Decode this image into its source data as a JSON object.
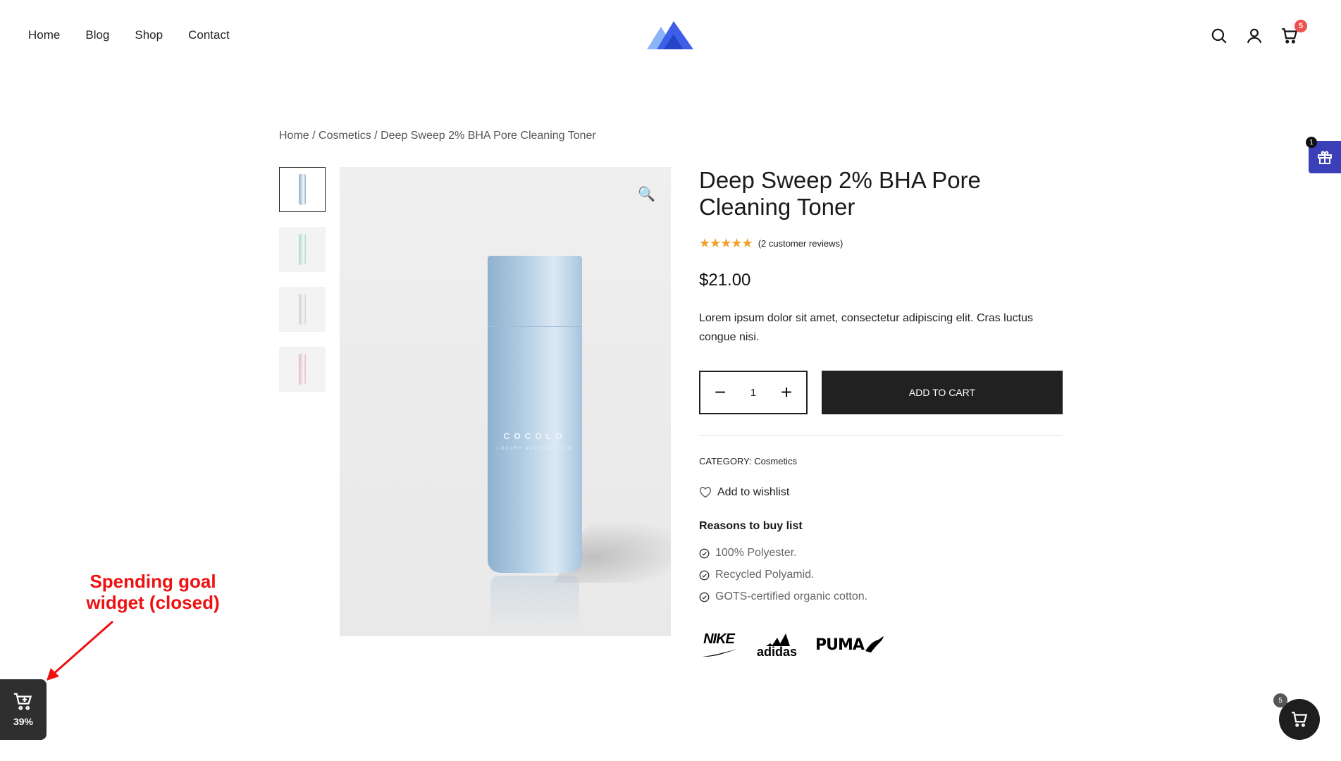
{
  "nav": {
    "items": [
      "Home",
      "Blog",
      "Shop",
      "Contact"
    ]
  },
  "header": {
    "cart_count": "5"
  },
  "breadcrumb": {
    "home": "Home",
    "category": "Cosmetics",
    "current": "Deep Sweep 2% BHA Pore Cleaning Toner",
    "sep": " / "
  },
  "product": {
    "title": "Deep Sweep 2% BHA Pore Cleaning Toner",
    "stars": "★★★★★",
    "reviews": "(2 customer reviews)",
    "price": "$21.00",
    "description": "Lorem ipsum dolor sit amet, consectetur adipiscing elit. Cras luctus congue nisi.",
    "brand_on_bottle": "COCOLO",
    "sub_on_bottle": "LUXURY NATURAL SKIN",
    "thumbnail_colors": [
      "#8fb1cf",
      "#a8dcc4",
      "#cfcfcf",
      "#e6b9c2"
    ],
    "quantity": "1",
    "minus": "−",
    "plus": "+",
    "add_to_cart": "ADD TO CART",
    "category_label": "CATEGORY: ",
    "category_value": "Cosmetics",
    "wishlist": "Add to wishlist",
    "reasons_title": "Reasons to buy list",
    "reasons": [
      "100% Polyester.",
      "Recycled Polyamid.",
      "GOTS-certified organic cotton."
    ],
    "brands": [
      "NIKE",
      "adidas",
      "PUMA"
    ]
  },
  "floating": {
    "gift_count": "1",
    "spending_percent": "39%",
    "mini_cart_count": "5"
  },
  "annotation": {
    "line1": "Spending goal",
    "line2": "widget (closed)"
  },
  "colors": {
    "accent_gift": "#3b3fb8",
    "badge_red": "#ee4f4f",
    "star": "#f2a12b",
    "annotation": "#ee1111"
  }
}
